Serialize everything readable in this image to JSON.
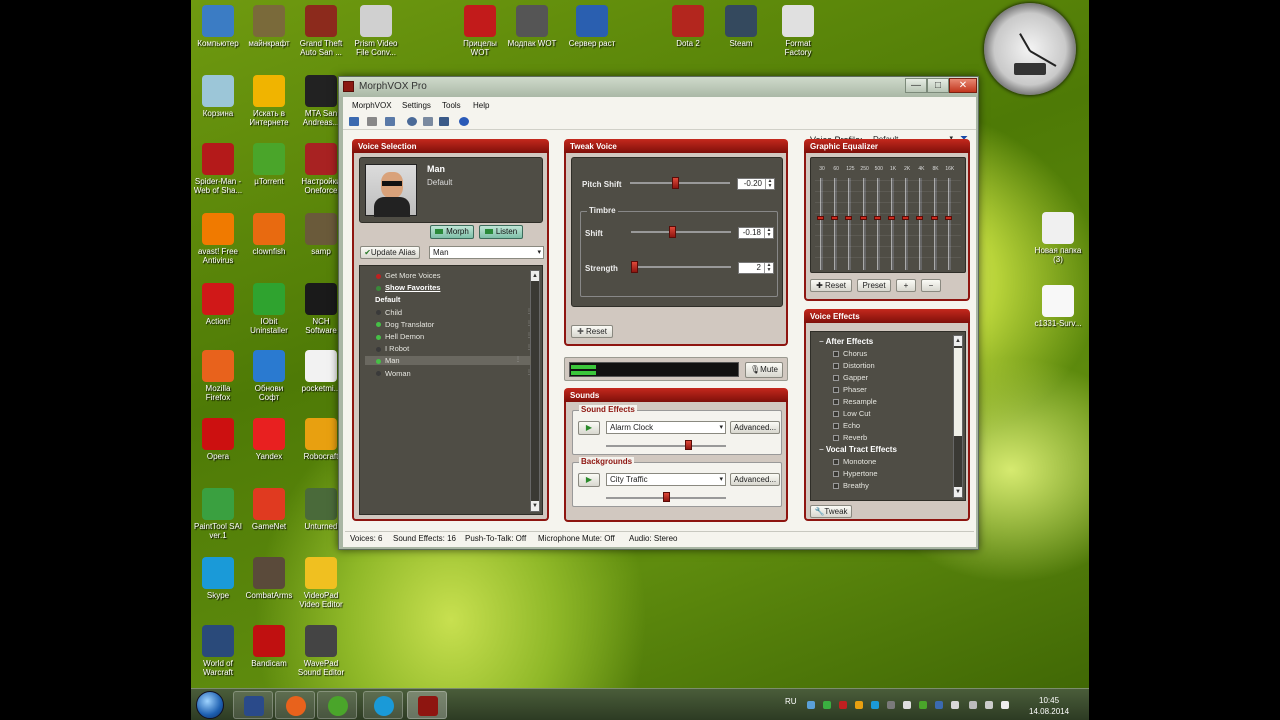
{
  "desktop": {
    "icons": [
      {
        "label": "Компьютер",
        "color": "#3b7cc4"
      },
      {
        "label": "майнкрафт",
        "color": "#7a6a3a"
      },
      {
        "label": "Grand Theft Auto San ...",
        "color": "#8c2a1c"
      },
      {
        "label": "Prism Video File Conv...",
        "color": "#d0d0d0"
      },
      {
        "label": "Прицелы WOT",
        "color": "#c21b1b"
      },
      {
        "label": "Модпак WOT",
        "color": "#555555"
      },
      {
        "label": "Сервер раст",
        "color": "#2a5fb0"
      },
      {
        "label": "Dota 2",
        "color": "#b3261e"
      },
      {
        "label": "Steam",
        "color": "#34495e"
      },
      {
        "label": "Format Factory",
        "color": "#e0e0e0"
      },
      {
        "label": "Корзина",
        "color": "#9cc6d8"
      },
      {
        "label": "Искать в Интернете",
        "color": "#f0b400"
      },
      {
        "label": "MTA San Andreas...",
        "color": "#222222"
      },
      {
        "label": "Spider-Man - Web of Sha...",
        "color": "#b41a1a"
      },
      {
        "label": "µTorrent",
        "color": "#4aa52a"
      },
      {
        "label": "Настройки Oneforce",
        "color": "#a82222"
      },
      {
        "label": "avast! Free Antivirus",
        "color": "#f07a00"
      },
      {
        "label": "clownfish",
        "color": "#e86a10"
      },
      {
        "label": "samp",
        "color": "#6a5a3a"
      },
      {
        "label": "Action!",
        "color": "#d01818"
      },
      {
        "label": "IObit Uninstaller",
        "color": "#2fa32f"
      },
      {
        "label": "NCH Software",
        "color": "#1a1a1a"
      },
      {
        "label": "Mozilla Firefox",
        "color": "#e8621c"
      },
      {
        "label": "Обнови Софт",
        "color": "#2a7ad0"
      },
      {
        "label": "pocketmi...",
        "color": "#f2f2f2"
      },
      {
        "label": "Opera",
        "color": "#cc1010"
      },
      {
        "label": "Yandex",
        "color": "#e82020"
      },
      {
        "label": "Robocraft",
        "color": "#e8a010"
      },
      {
        "label": "PaintTool SAI ver.1",
        "color": "#3aa040"
      },
      {
        "label": "GameNet",
        "color": "#e03a20"
      },
      {
        "label": "Unturned",
        "color": "#4a6a3a"
      },
      {
        "label": "Skype",
        "color": "#1a9ad8"
      },
      {
        "label": "CombatArms",
        "color": "#5a4a3a"
      },
      {
        "label": "VideoPad Video Editor",
        "color": "#f0c020"
      },
      {
        "label": "World of Warcraft",
        "color": "#2a4a7a"
      },
      {
        "label": "Bandicam",
        "color": "#c01010"
      },
      {
        "label": "WavePad Sound Editor",
        "color": "#444444"
      },
      {
        "label": "Новая папка (3)",
        "color": "#f0f0f0"
      },
      {
        "label": "c1331-Surv...",
        "color": "#f8f8f8"
      }
    ]
  },
  "window": {
    "title": "MorphVOX Pro",
    "controls": {
      "minimize": "—",
      "maximize": "□",
      "close": "✕"
    },
    "menu": [
      "MorphVOX",
      "Settings",
      "Tools",
      "Help"
    ],
    "voice_profile_label": "Voice Profile:",
    "voice_profile_value": "Default",
    "voice_selection": {
      "title": "Voice Selection",
      "current_name": "Man",
      "current_sub": "Default",
      "morph": "Morph",
      "listen": "Listen",
      "update_alias": "Update Alias",
      "alias_value": "Man",
      "list": [
        {
          "text": "Get More Voices",
          "kind": "link"
        },
        {
          "text": "Show Favorites",
          "kind": "bold"
        },
        {
          "text": "Default",
          "kind": "group"
        },
        {
          "text": "Child",
          "kind": "item"
        },
        {
          "text": "Dog Translator",
          "kind": "item"
        },
        {
          "text": "Hell Demon",
          "kind": "item"
        },
        {
          "text": "I Robot",
          "kind": "item"
        },
        {
          "text": "Man",
          "kind": "selected"
        },
        {
          "text": "Woman",
          "kind": "item"
        }
      ]
    },
    "tweak_voice": {
      "title": "Tweak Voice",
      "pitch_label": "Pitch Shift",
      "pitch_value": "-0.20",
      "timbre_label": "Timbre",
      "shift_label": "Shift",
      "shift_value": "-0.18",
      "strength_label": "Strength",
      "strength_value": "2",
      "reset": "Reset"
    },
    "level_meter": {
      "level": 0.15,
      "mute": "Mute"
    },
    "sounds": {
      "title": "Sounds",
      "effects_label": "Sound Effects",
      "effect_value": "Alarm Clock",
      "effect_volume": 0.7,
      "backgrounds_label": "Backgrounds",
      "background_value": "City Traffic",
      "background_volume": 0.5,
      "advanced": "Advanced..."
    },
    "equalizer": {
      "title": "Graphic Equalizer",
      "bands": [
        "30",
        "60",
        "125",
        "250",
        "500",
        "1K",
        "2K",
        "4K",
        "8K",
        "16K"
      ],
      "reset": "Reset",
      "preset": "Preset",
      "plus": "+",
      "minus": "−"
    },
    "voice_effects": {
      "title": "Voice Effects",
      "items": [
        {
          "text": "After Effects",
          "kind": "group"
        },
        {
          "text": "Chorus",
          "kind": "item"
        },
        {
          "text": "Distortion",
          "kind": "item"
        },
        {
          "text": "Gapper",
          "kind": "item"
        },
        {
          "text": "Phaser",
          "kind": "item"
        },
        {
          "text": "Resample",
          "kind": "item"
        },
        {
          "text": "Low Cut",
          "kind": "item"
        },
        {
          "text": "Echo",
          "kind": "item"
        },
        {
          "text": "Reverb",
          "kind": "item"
        },
        {
          "text": "Vocal Tract Effects",
          "kind": "group"
        },
        {
          "text": "Monotone",
          "kind": "item"
        },
        {
          "text": "Hypertone",
          "kind": "item"
        },
        {
          "text": "Breathy",
          "kind": "item"
        }
      ],
      "tweak": "Tweak"
    },
    "status": {
      "voices": "Voices: 6",
      "sound_effects": "Sound Effects: 16",
      "ptt": "Push-To-Talk: Off",
      "mic_mute": "Microphone Mute: Off",
      "audio": "Audio: Stereo"
    }
  },
  "taskbar": {
    "lang": "RU",
    "time": "10:45",
    "date": "14.08.2014"
  }
}
